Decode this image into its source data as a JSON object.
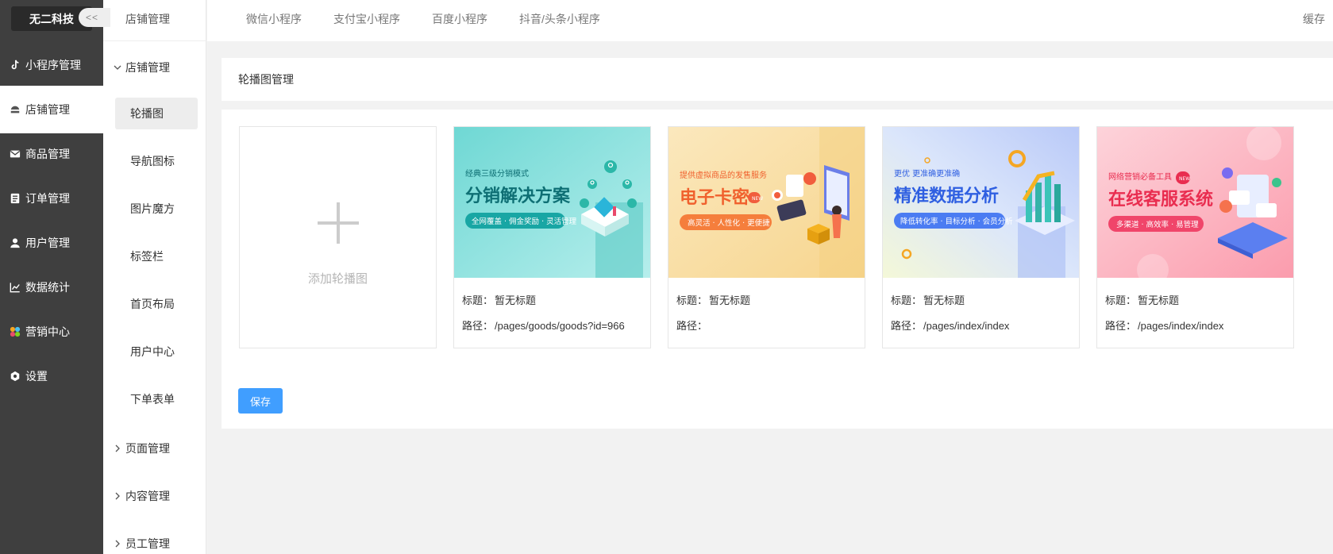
{
  "brand": "无二科技",
  "nav1": [
    {
      "label": "小程序管理",
      "icon": "tiktok-icon"
    },
    {
      "label": "店铺管理",
      "icon": "store-icon"
    },
    {
      "label": "商品管理",
      "icon": "mail-icon"
    },
    {
      "label": "订单管理",
      "icon": "order-icon"
    },
    {
      "label": "用户管理",
      "icon": "user-icon"
    },
    {
      "label": "数据统计",
      "icon": "chart-icon"
    },
    {
      "label": "营销中心",
      "icon": "marketing-icon"
    },
    {
      "label": "设置",
      "icon": "gear-icon"
    }
  ],
  "nav2": {
    "title": "店铺管理",
    "collapse": "<<",
    "groups": {
      "store": "店铺管理",
      "page": "页面管理",
      "content": "内容管理",
      "staff": "员工管理"
    },
    "items": [
      "轮播图",
      "导航图标",
      "图片魔方",
      "标签栏",
      "首页布局",
      "用户中心",
      "下单表单"
    ]
  },
  "tabs": [
    "微信小程序",
    "支付宝小程序",
    "百度小程序",
    "抖音/头条小程序"
  ],
  "cache": "缓存",
  "section_title": "轮播图管理",
  "add_label": "添加轮播图",
  "title_key": "标题：",
  "path_key": "路径：",
  "banners": [
    {
      "small": "经典三级分销模式",
      "big": "分销解决方案",
      "pill": "全网覆盖 · 佣金奖励 · 灵活管理",
      "title": "暂无标题",
      "path": "/pages/goods/goods?id=966",
      "colors": {
        "bg1": "#9de8e3",
        "bg2": "#d2f4f2",
        "text": "#0e6f74",
        "pill": "#18a6a4"
      }
    },
    {
      "small": "提供虚拟商品的发售服务",
      "big": "电子卡密",
      "pill": "高灵活 · 人性化 · 更便捷",
      "title": "暂无标题",
      "path": "",
      "colors": {
        "bg1": "#f9dfa3",
        "bg2": "#fbefd4",
        "text": "#f0612e",
        "pill": "#f57e3c"
      }
    },
    {
      "small": "更优 更准确更准确",
      "big": "精准数据分析",
      "pill": "降低转化率 · 目标分析 · 会员分析",
      "title": "暂无标题",
      "path": "/pages/index/index",
      "colors": {
        "bg1": "#c6d5fb",
        "bg2": "#f1f7d9",
        "text": "#2f5fe1",
        "pill": "#4b7cf2"
      }
    },
    {
      "small": "网络营销必备工具",
      "big": "在线客服系统",
      "pill": "多渠道 · 高效率 · 易管理",
      "title": "暂无标题",
      "path": "/pages/index/index",
      "colors": {
        "bg1": "#fb9fb0",
        "bg2": "#fdd7dd",
        "text": "#e92d50",
        "pill": "#f0456a"
      }
    }
  ],
  "save": "保存",
  "new_badge": "NEW"
}
